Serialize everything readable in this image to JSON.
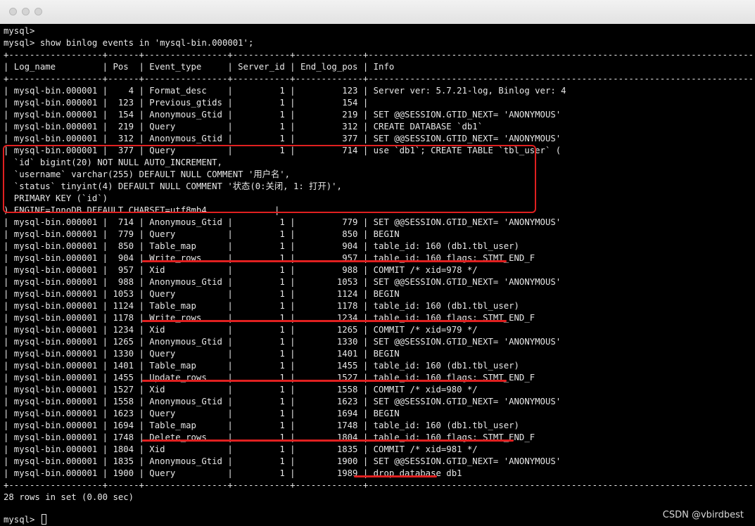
{
  "terminal": {
    "prompt_line": "mysql>",
    "command_line": "mysql> show binlog events in 'mysql-bin.000001';",
    "separator": "+------------------+------+----------------+-----------+-------------+-----------------------------------------------------------------------------------------------------------------",
    "header": "| Log_name         | Pos  | Event_type     | Server_id | End_log_pos | Info",
    "rows": [
      "| mysql-bin.000001 |    4 | Format_desc    |         1 |         123 | Server ver: 5.7.21-log, Binlog ver: 4",
      "| mysql-bin.000001 |  123 | Previous_gtids |         1 |         154 |",
      "| mysql-bin.000001 |  154 | Anonymous_Gtid |         1 |         219 | SET @@SESSION.GTID_NEXT= 'ANONYMOUS'",
      "| mysql-bin.000001 |  219 | Query          |         1 |         312 | CREATE DATABASE `db1`",
      "| mysql-bin.000001 |  312 | Anonymous_Gtid |         1 |         377 | SET @@SESSION.GTID_NEXT= 'ANONYMOUS'",
      "| mysql-bin.000001 |  377 | Query          |         1 |         714 | use `db1`; CREATE TABLE `tbl_user` (",
      "  `id` bigint(20) NOT NULL AUTO_INCREMENT,",
      "  `username` varchar(255) DEFAULT NULL COMMENT '用户名',",
      "  `status` tinyint(4) DEFAULT NULL COMMENT '状态(0:关闭, 1: 打开)',",
      "  PRIMARY KEY (`id`)",
      ") ENGINE=InnoDB DEFAULT CHARSET=utf8mb4             |",
      "| mysql-bin.000001 |  714 | Anonymous_Gtid |         1 |         779 | SET @@SESSION.GTID_NEXT= 'ANONYMOUS'",
      "| mysql-bin.000001 |  779 | Query          |         1 |         850 | BEGIN",
      "| mysql-bin.000001 |  850 | Table_map      |         1 |         904 | table_id: 160 (db1.tbl_user)",
      "| mysql-bin.000001 |  904 | Write_rows     |         1 |         957 | table_id: 160 flags: STMT_END_F",
      "| mysql-bin.000001 |  957 | Xid            |         1 |         988 | COMMIT /* xid=978 */",
      "| mysql-bin.000001 |  988 | Anonymous_Gtid |         1 |        1053 | SET @@SESSION.GTID_NEXT= 'ANONYMOUS'",
      "| mysql-bin.000001 | 1053 | Query          |         1 |        1124 | BEGIN",
      "| mysql-bin.000001 | 1124 | Table_map      |         1 |        1178 | table_id: 160 (db1.tbl_user)",
      "| mysql-bin.000001 | 1178 | Write_rows     |         1 |        1234 | table_id: 160 flags: STMT_END_F",
      "| mysql-bin.000001 | 1234 | Xid            |         1 |        1265 | COMMIT /* xid=979 */",
      "| mysql-bin.000001 | 1265 | Anonymous_Gtid |         1 |        1330 | SET @@SESSION.GTID_NEXT= 'ANONYMOUS'",
      "| mysql-bin.000001 | 1330 | Query          |         1 |        1401 | BEGIN",
      "| mysql-bin.000001 | 1401 | Table_map      |         1 |        1455 | table_id: 160 (db1.tbl_user)",
      "| mysql-bin.000001 | 1455 | Update_rows    |         1 |        1527 | table_id: 160 flags: STMT_END_F",
      "| mysql-bin.000001 | 1527 | Xid            |         1 |        1558 | COMMIT /* xid=980 */",
      "| mysql-bin.000001 | 1558 | Anonymous_Gtid |         1 |        1623 | SET @@SESSION.GTID_NEXT= 'ANONYMOUS'",
      "| mysql-bin.000001 | 1623 | Query          |         1 |        1694 | BEGIN",
      "| mysql-bin.000001 | 1694 | Table_map      |         1 |        1748 | table_id: 160 (db1.tbl_user)",
      "| mysql-bin.000001 | 1748 | Delete_rows    |         1 |        1804 | table_id: 160 flags: STMT_END_F",
      "| mysql-bin.000001 | 1804 | Xid            |         1 |        1835 | COMMIT /* xid=981 */",
      "| mysql-bin.000001 | 1835 | Anonymous_Gtid |         1 |        1900 | SET @@SESSION.GTID_NEXT= 'ANONYMOUS'",
      "| mysql-bin.000001 | 1900 | Query          |         1 |        1989 | drop database db1"
    ],
    "result_summary": "28 rows in set (0.00 sec)",
    "final_prompt": "mysql> "
  },
  "watermark": "CSDN @vbirdbest",
  "colors": {
    "background": "#000000",
    "text": "#e8e8e8",
    "annotation": "#e02020"
  }
}
